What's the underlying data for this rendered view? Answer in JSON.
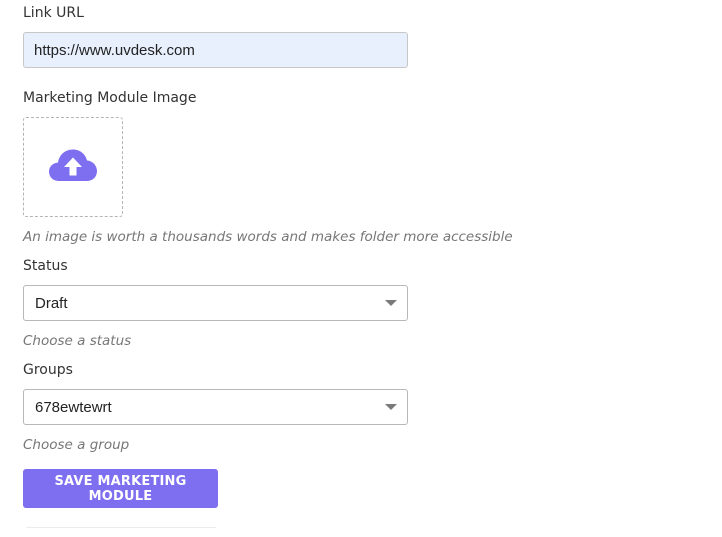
{
  "link_url": {
    "label": "Link URL",
    "value": "https://www.uvdesk.com"
  },
  "image": {
    "label": "Marketing Module Image",
    "icon": "cloud-upload-icon",
    "hint": "An image is worth a thousands words and makes folder more accessible"
  },
  "status": {
    "label": "Status",
    "selected": "Draft",
    "hint": "Choose a status"
  },
  "groups": {
    "label": "Groups",
    "selected": "678ewtewrt",
    "hint": "Choose a group"
  },
  "actions": {
    "save_label": "SAVE MARKETING MODULE"
  },
  "colors": {
    "accent": "#7e6ff0",
    "autofill_bg": "#e8f0fe",
    "hint_text": "#777777"
  }
}
